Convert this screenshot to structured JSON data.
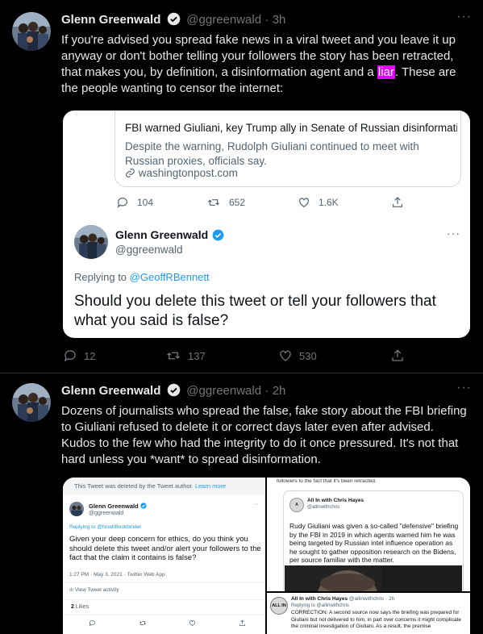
{
  "tweet1": {
    "name": "Glenn Greenwald",
    "handle": "@ggreenwald",
    "time": "3h",
    "text_a": "If you're advised you spread fake news in a viral tweet and you leave it up anyway or don't bother telling your followers the story has been retracted, that makes you, by definition, a disinformation agent and a ",
    "text_hl": "liar",
    "text_b": ". These are the people wanting to censor the internet:",
    "embed": {
      "link_title": "FBI warned Giuliani, key Trump ally in Senate of Russian disinformati...",
      "link_desc": "Despite the warning, Rudolph Giuliani continued to meet with Russian proxies, officials say.",
      "link_domain": "washingtonpost.com",
      "stats": {
        "replies": "104",
        "retweets": "652",
        "likes": "1.6K"
      },
      "name": "Glenn Greenwald",
      "handle": "@ggreenwald",
      "replying_label": "Replying to",
      "replying_to": "@GeoffRBennett",
      "quote_text": "Should you delete this tweet or tell your followers that what you said is false?"
    },
    "actions": {
      "replies": "12",
      "retweets": "137",
      "likes": "530"
    }
  },
  "tweet2": {
    "name": "Glenn Greenwald",
    "handle": "@ggreenwald",
    "time": "2h",
    "text": "Dozens of journalists who spread the false, fake story about the FBI briefing to Giuliani refused to delete it or correct days later even after advised. Kudos to the few who had the integrity to do it once pressured. It's not that hard unless you *want* to spread disinformation.",
    "img_left": {
      "deleted_notice": "This Tweet was deleted by the Tweet author.",
      "learn_more": "Learn more",
      "name": "Glenn Greenwald",
      "handle": "@ggreenwald",
      "replying": "Replying to @NoahBookbinder",
      "text": "Given your deep concern for ethics, do you think you should delete this tweet and/or alert your followers to the fact that the claim it contains is false?",
      "meta": "1:27 PM · May 3, 2021 · Twitter Web App",
      "view_activity": "View Tweet activity",
      "likes_count": "2",
      "likes_label": "Likes"
    },
    "img_right_top": {
      "top_text": "followers to the fact that it's been retracted.",
      "name": "All In with Chris Hayes",
      "handle": "@allinwithchris",
      "text": "Rudy Giuliani was given a so-called \"defensive\" briefing by the FBI in 2019 in which agents warned him he was being targeted by Russian intel influence operation as he sought to gather opposition research on the Bidens, per source familiar with the matter."
    },
    "img_right_bottom": {
      "logo": "ALL IN",
      "name": "All In with Chris Hayes",
      "handle": "@allinwithchris · 2h",
      "replying": "Replying to @allinwithchris",
      "text": "CORRECTION: A second source now says the briefing was prepared for Giuliani but not delivered to him, in part over concerns it might complicate the criminal investigation of Giuliani. As a result, the premise"
    }
  },
  "colors": {
    "accent": "#1d9bf0",
    "highlight": "#e100ff",
    "verified": "#1d9bf0"
  }
}
